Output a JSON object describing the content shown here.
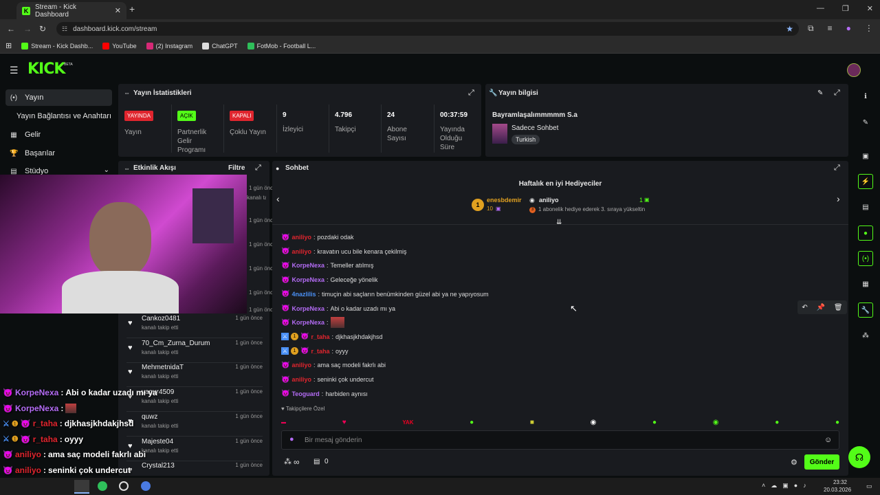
{
  "browser": {
    "tab_title": "Stream - Kick Dashboard",
    "url": "dashboard.kick.com/stream",
    "bookmarks": [
      {
        "label": "Stream - Kick Dashb...",
        "color": "#53fc18"
      },
      {
        "label": "YouTube",
        "color": "#ff0000"
      },
      {
        "label": "(2) Instagram",
        "color": "#d62976"
      },
      {
        "label": "ChatGPT",
        "color": "#dddddd"
      },
      {
        "label": "FotMob - Football L...",
        "color": "#2fbf5a"
      }
    ]
  },
  "brand": {
    "logo": "KICK",
    "beta": "BETA",
    "accent": "#53fc18"
  },
  "sidebar": {
    "items": [
      {
        "label": "Yayın",
        "icon": "(•)"
      },
      {
        "label": "Yayın Bağlantısı ve Anahtarı",
        "icon": ""
      },
      {
        "label": "Gelir",
        "icon": "▦"
      },
      {
        "label": "Başarılar",
        "icon": "🏆"
      },
      {
        "label": "Stüdyo",
        "icon": "▤"
      }
    ]
  },
  "stats_panel": {
    "title": "Yayın İstatistikleri",
    "items": [
      {
        "badge": "YAYINDA",
        "label": "Yayın",
        "badge_color": "#e0252e"
      },
      {
        "badge": "AÇIK",
        "label": "Partnerlik Gelir Programı",
        "badge_color": "#53fc18"
      },
      {
        "badge": "KAPALI",
        "label": "Çoklu Yayın",
        "badge_color": "#e0252e"
      },
      {
        "value": "9",
        "label": "İzleyici"
      },
      {
        "value": "4.796",
        "label": "Takipçi"
      },
      {
        "value": "24",
        "label": "Abone Sayısı"
      },
      {
        "value": "00:37:59",
        "label": "Yayında Olduğu Süre"
      }
    ]
  },
  "info_panel": {
    "title": "Yayın bilgisi",
    "stream_title": "Bayramlaşalımmmmm S.a",
    "category": "Sadece Sohbet",
    "language": "Turkish"
  },
  "events_panel": {
    "title": "Etkinlik Akışı",
    "filter": "Filtre",
    "hidden_times": [
      "1 gün önce",
      "1 gün önce",
      "1 gün önce",
      "1 gün önce",
      "1 gün önce",
      "1 gün önce"
    ],
    "hidden_sub": "kanalı takip etti",
    "items": [
      {
        "name": "Cankoz0481",
        "sub": "kanalı takip etti",
        "time": "1 gün önce"
      },
      {
        "name": "70_Cm_Zurna_Durum",
        "sub": "kanalı takip etti",
        "time": "1 gün önce"
      },
      {
        "name": "MehmetnidaT",
        "sub": "kanalı takip etti",
        "time": "1 gün önce"
      },
      {
        "name": "yagur4509",
        "sub": "kanalı takip etti",
        "time": "1 gün önce"
      },
      {
        "name": "quwz",
        "sub": "kanalı takip etti",
        "time": "1 gün önce"
      },
      {
        "name": "Majeste04",
        "sub": "kanalı takip etti",
        "time": "1 gün önce"
      },
      {
        "name": "Crystal213",
        "sub": "",
        "time": "1 gün önce"
      }
    ]
  },
  "chat_panel": {
    "title": "Sohbet",
    "gifters_title": "Haftalık en iyi Hediyeciler",
    "top_gifter": {
      "rank": "1",
      "name": "enesbdemir",
      "count": "10"
    },
    "second_gifter": {
      "name": "aniliyo",
      "count": "1",
      "note": "1 abonelik hediye ederek 3. sıraya yükseltin",
      "rank_hint": "3"
    },
    "messages": [
      {
        "user": "aniliyo",
        "color": "#e0252e",
        "text": "pozdaki odak",
        "badges": []
      },
      {
        "user": "aniliyo",
        "color": "#e0252e",
        "text": "kravatın ucu bile kenara çekilmiş",
        "badges": []
      },
      {
        "user": "KorpeNexa",
        "color": "#b46cf5",
        "text": "Temeller atılmış",
        "badges": []
      },
      {
        "user": "KorpeNexa",
        "color": "#b46cf5",
        "text": "Geleceğe yönelik",
        "badges": []
      },
      {
        "user": "4nazlilis",
        "color": "#4a90f5",
        "text": "timuçin abi saçların benümkinden güzel abi ya ne yapıyosum",
        "badges": []
      },
      {
        "user": "KorpeNexa",
        "color": "#b46cf5",
        "text": "Abi o kadar uzadı mı ya",
        "badges": []
      },
      {
        "user": "KorpeNexa",
        "color": "#b46cf5",
        "text": "",
        "badges": [],
        "emote": true
      },
      {
        "user": "r_taha",
        "color": "#e0252e",
        "text": "djkhasjkhdakjhsd",
        "badges": [
          "mod",
          "sub"
        ]
      },
      {
        "user": "r_taha",
        "color": "#e0252e",
        "text": "oyyy",
        "badges": [
          "mod",
          "sub"
        ]
      },
      {
        "user": "aniliyo",
        "color": "#e0252e",
        "text": "ama saç modeli fakrlı abi",
        "badges": []
      },
      {
        "user": "aniliyo",
        "color": "#e0252e",
        "text": "seninki çok undercut",
        "badges": []
      },
      {
        "user": "Teoguard",
        "color": "#b46cf5",
        "text": "harbiden aynısı",
        "badges": []
      }
    ],
    "followers_only": "Takipçilere Özel",
    "emote_text": "YAK",
    "input_placeholder": "Bir mesaj gönderin",
    "send_label": "Gönder",
    "infinity": "∞",
    "count": "0"
  },
  "overlay_chat": [
    {
      "user": "KorpeNexa",
      "text": "Abi o kadar uzadı mı ya",
      "color": "#b46cf5"
    },
    {
      "user": "KorpeNexa",
      "text": "",
      "color": "#b46cf5"
    },
    {
      "user": "r_taha",
      "text": "djkhasjkhdakjhsd",
      "color": "#e0252e"
    },
    {
      "user": "r_taha",
      "text": "oyyy",
      "color": "#e0252e"
    },
    {
      "user": "aniliyo",
      "text": "ama saç modeli fakrlı abi",
      "color": "#e0252e"
    },
    {
      "user": "aniliyo",
      "text": "seninki çok undercut",
      "color": "#e0252e"
    },
    {
      "user": "Teoguard",
      "text": "harbiden aynısı",
      "color": "#b46cf5"
    }
  ],
  "taskbar": {
    "time": "23:32",
    "date": "20.03.2026"
  }
}
